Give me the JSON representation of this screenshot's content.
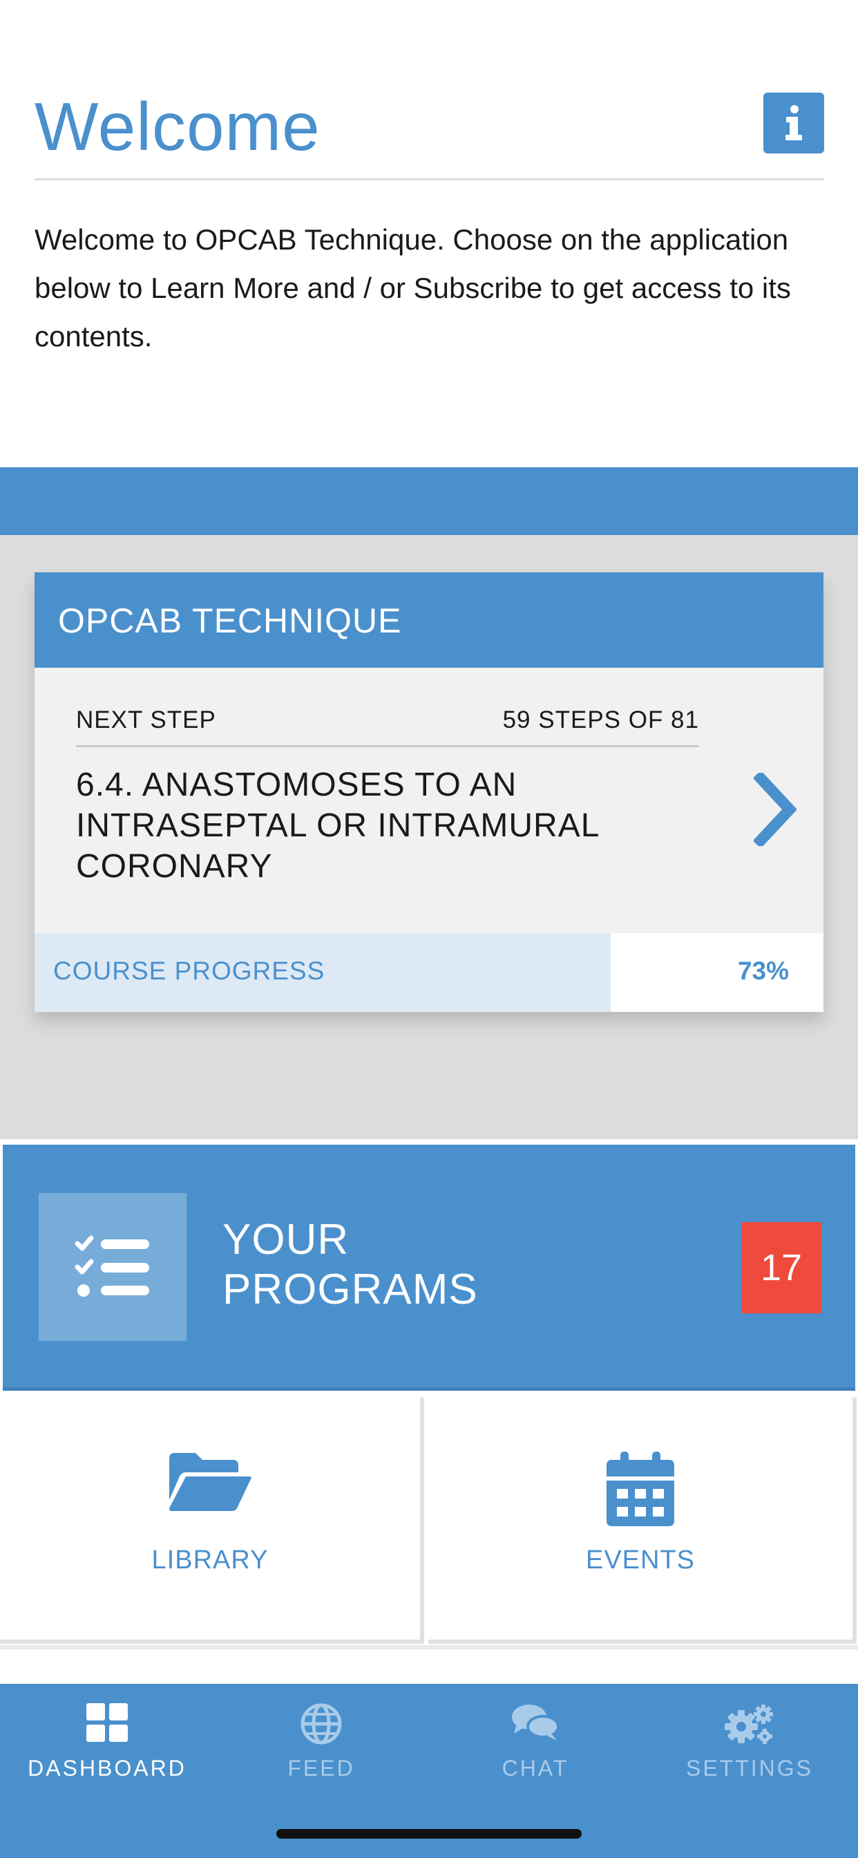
{
  "header": {
    "title": "Welcome",
    "intro": "Welcome to OPCAB Technique. Choose on the application below to Learn More and / or Subscribe to get access to its contents."
  },
  "course_card": {
    "title": "OPCAB TECHNIQUE",
    "next_step_label": "NEXT STEP",
    "steps_count": "59 STEPS OF 81",
    "step_title": "6.4. ANASTOMOSES TO AN INTRASEPTAL OR INTRAMURAL CORONARY",
    "progress_label": "COURSE PROGRESS",
    "progress_text": "73%",
    "progress_value": 0.73
  },
  "programs": {
    "label": "YOUR PROGRAMS",
    "badge": "17"
  },
  "tiles": [
    {
      "label": "LIBRARY",
      "icon": "folder-open-icon"
    },
    {
      "label": "EVENTS",
      "icon": "calendar-icon"
    }
  ],
  "nav": [
    {
      "label": "DASHBOARD",
      "icon": "grid-icon",
      "active": true
    },
    {
      "label": "FEED",
      "icon": "globe-icon",
      "active": false
    },
    {
      "label": "CHAT",
      "icon": "chat-bubbles-icon",
      "active": false
    },
    {
      "label": "SETTINGS",
      "icon": "gears-icon",
      "active": false
    }
  ],
  "colors": {
    "brand_blue": "#4a90cd",
    "badge_red": "#ef4a3c",
    "progress_fill": "#dde9f5",
    "nav_inactive": "#a9cbea"
  }
}
